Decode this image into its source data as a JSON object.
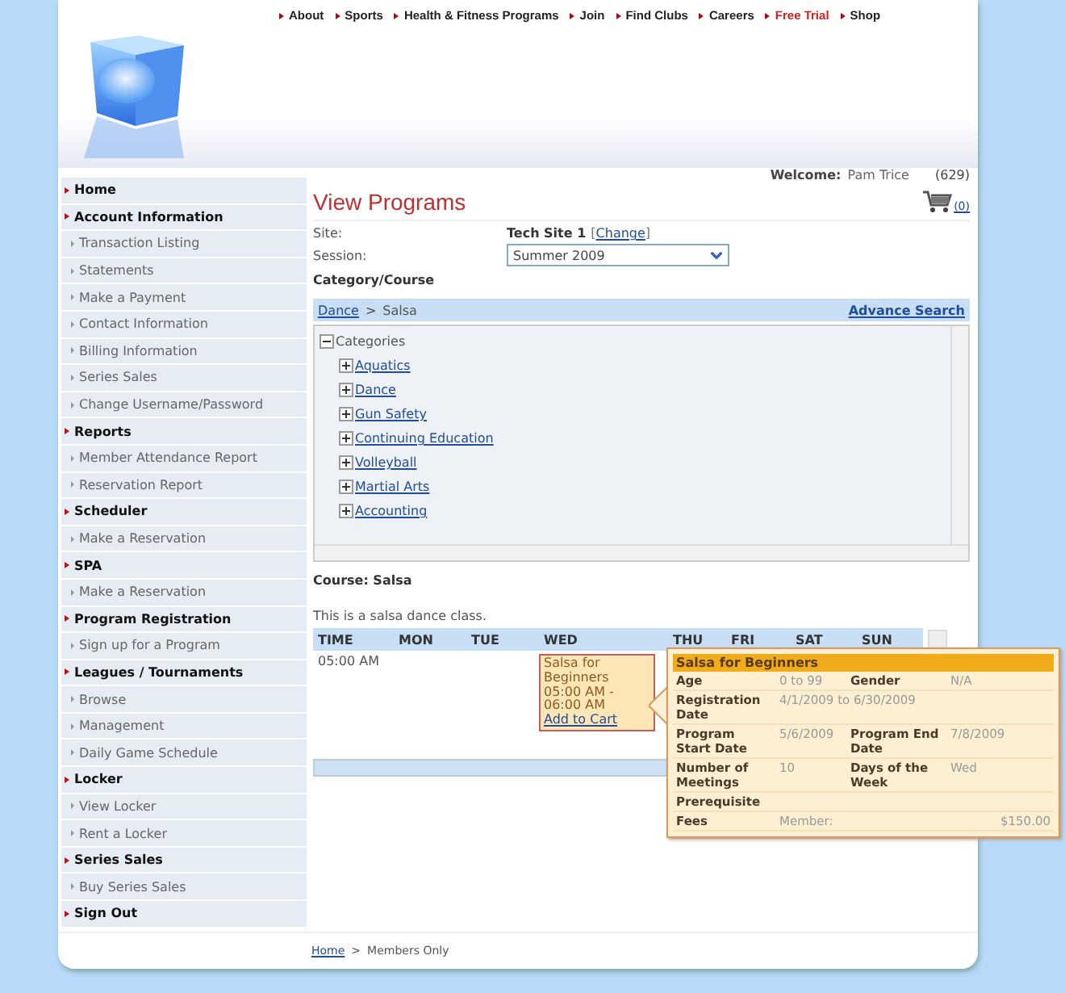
{
  "top_nav": [
    {
      "label": "About",
      "highlighted": false
    },
    {
      "label": "Sports",
      "highlighted": false
    },
    {
      "label": "Health & Fitness Programs",
      "highlighted": false
    },
    {
      "label": "Join",
      "highlighted": false
    },
    {
      "label": "Find Clubs",
      "highlighted": false
    },
    {
      "label": "Careers",
      "highlighted": false
    },
    {
      "label": "Free Trial",
      "highlighted": true
    },
    {
      "label": "Shop",
      "highlighted": false
    }
  ],
  "sidebar": [
    {
      "label": "Home"
    },
    {
      "label": "Account Information",
      "children": [
        {
          "label": "Transaction Listing"
        },
        {
          "label": "Statements"
        },
        {
          "label": "Make a Payment"
        },
        {
          "label": "Contact Information"
        },
        {
          "label": "Billing Information"
        },
        {
          "label": "Series Sales"
        },
        {
          "label": "Change Username/Password"
        }
      ]
    },
    {
      "label": "Reports",
      "children": [
        {
          "label": "Member Attendance Report"
        },
        {
          "label": "Reservation Report"
        }
      ]
    },
    {
      "label": "Scheduler",
      "children": [
        {
          "label": "Make a Reservation"
        }
      ]
    },
    {
      "label": "SPA",
      "children": [
        {
          "label": "Make a Reservation"
        }
      ]
    },
    {
      "label": "Program Registration",
      "children": [
        {
          "label": "Sign up for a Program"
        }
      ]
    },
    {
      "label": "Leagues / Tournaments",
      "children": [
        {
          "label": "Browse"
        },
        {
          "label": "Management"
        },
        {
          "label": "Daily Game Schedule"
        }
      ]
    },
    {
      "label": "Locker",
      "children": [
        {
          "label": "View Locker"
        },
        {
          "label": "Rent a Locker"
        }
      ]
    },
    {
      "label": "Series Sales",
      "children": [
        {
          "label": "Buy Series Sales"
        }
      ]
    },
    {
      "label": "Sign Out"
    }
  ],
  "header": {
    "welcome_label": "Welcome:",
    "user": "Pam Trice",
    "points": "(629)",
    "cart_count": "(0)"
  },
  "page_title": "View Programs",
  "site": {
    "label": "Site:",
    "value": "Tech Site 1",
    "bracket_open": "[",
    "link": "Change",
    "bracket_close": "]"
  },
  "session": {
    "label": "Session:",
    "value": "Summer 2009"
  },
  "category_heading": "Category/Course",
  "breadcrumb": {
    "items": [
      {
        "label": "Dance",
        "kind": "link"
      },
      {
        "label": "Salsa",
        "kind": "current"
      }
    ],
    "separator": ">",
    "advance_search": "Advance Search"
  },
  "tree": {
    "label": "Categories",
    "expanded": true,
    "children": [
      {
        "label": "Aquatics",
        "expanded": false
      },
      {
        "label": "Dance",
        "expanded": false
      },
      {
        "label": "Gun Safety",
        "expanded": false
      },
      {
        "label": "Continuing Education",
        "expanded": false
      },
      {
        "label": "Volleyball",
        "expanded": false
      },
      {
        "label": "Martial Arts",
        "expanded": false
      },
      {
        "label": "Accounting",
        "expanded": false
      }
    ]
  },
  "course_title": "Course: Salsa",
  "description": "This is a salsa dance class.",
  "schedule": {
    "time_column": "TIME",
    "times": [
      "05:00 AM"
    ],
    "days": [
      {
        "label": "MON"
      },
      {
        "label": "TUE"
      },
      {
        "label": "WED",
        "events": [
          {
            "title": "Salsa for Beginners",
            "time": "05:00 AM - 06:00 AM",
            "link": "Add to Cart"
          }
        ]
      },
      {
        "label": "THU"
      },
      {
        "label": "FRI"
      },
      {
        "label": "SAT"
      },
      {
        "label": "SUN"
      }
    ]
  },
  "tooltip": {
    "title": "Salsa for Beginners",
    "rows": [
      [
        {
          "text": "Age",
          "kind": "label"
        },
        {
          "text": "0 to 99",
          "kind": "value"
        },
        {
          "text": "Gender",
          "kind": "label"
        },
        {
          "text": "N/A",
          "kind": "value"
        }
      ],
      [
        {
          "text": "Registration Date",
          "kind": "label"
        },
        {
          "text": "4/1/2009 to 6/30/2009",
          "kind": "value"
        }
      ],
      [
        {
          "text": "Program Start Date",
          "kind": "label"
        },
        {
          "text": "5/6/2009",
          "kind": "value"
        },
        {
          "text": "Program End Date",
          "kind": "label"
        },
        {
          "text": "7/8/2009",
          "kind": "value"
        }
      ],
      [
        {
          "text": "Number of Meetings",
          "kind": "label"
        },
        {
          "text": "10",
          "kind": "value"
        },
        {
          "text": "Days of the Week",
          "kind": "label"
        },
        {
          "text": "Wed",
          "kind": "value"
        }
      ],
      [
        {
          "text": "Prerequisite",
          "kind": "label"
        }
      ],
      [
        {
          "text": "Fees",
          "kind": "label"
        },
        {
          "text": "Member:",
          "kind": "value"
        },
        {
          "text": "$150.00",
          "kind": "value"
        }
      ]
    ]
  },
  "footer": {
    "items": [
      {
        "label": "Home",
        "kind": "link"
      },
      {
        "label": "Members Only",
        "kind": "current"
      }
    ],
    "separator": ">"
  }
}
